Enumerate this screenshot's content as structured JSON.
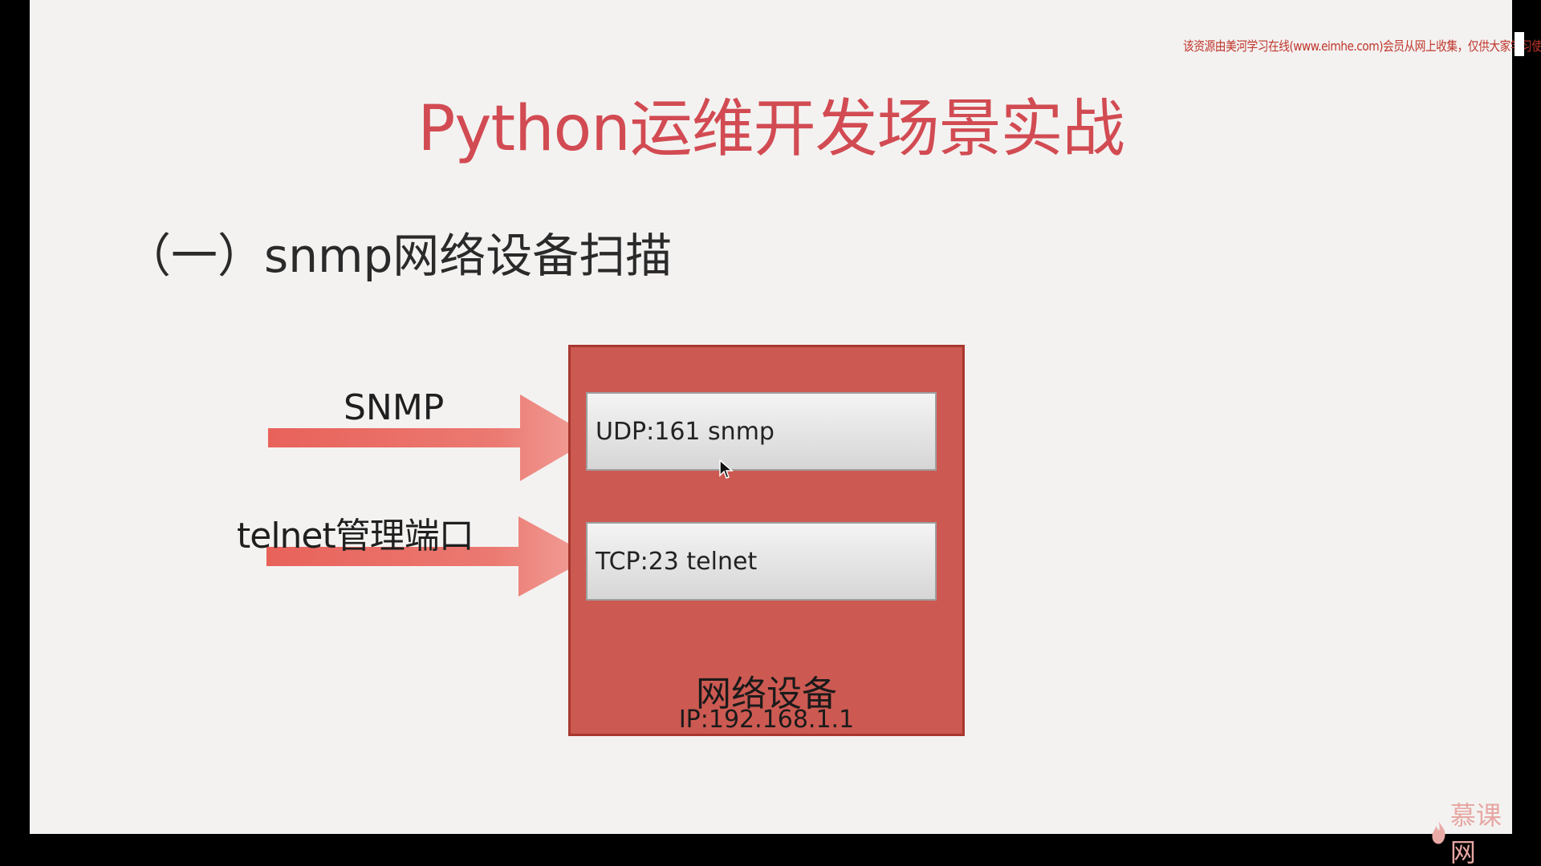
{
  "watermark": "该资源由美河学习在线(www.eimhe.com)会员从网上收集，仅供大家学习使用",
  "slide": {
    "title": "Python运维开发场景实战",
    "subtitle": "（一）snmp网络设备扫描"
  },
  "diagram": {
    "arrows": [
      {
        "label": "SNMP"
      },
      {
        "label": "telnet管理端口"
      }
    ],
    "device": {
      "ports": [
        "UDP:161 snmp",
        "TCP:23 telnet"
      ],
      "name": "网络设备",
      "ip": "IP:192.168.1.1"
    }
  },
  "logo": {
    "text": "慕课网",
    "icon": "flame-icon"
  },
  "colors": {
    "title": "#d24b52",
    "device_fill": "#cc5a52",
    "arrow": "#e8625a",
    "background": "#f3f2f1"
  }
}
